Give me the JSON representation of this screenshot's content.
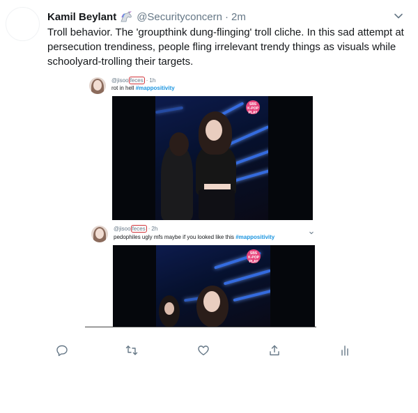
{
  "tweet": {
    "author_name": "Kamil Beylant",
    "author_emoji_icon": "unicorn-icon",
    "handle": "@Securityconcern",
    "separator": "·",
    "timestamp": "2m",
    "text": "Troll behavior. The 'groupthink dung-flinging' troll cliche.  In this sad attempt at persecution trendiness, people fling irrelevant trendy things as visuals while schoolyard-trolling their targets."
  },
  "embedded_screenshot": {
    "posts": [
      {
        "handle_prefix": "@jisoo",
        "handle_redacted": "feces",
        "separator": "·",
        "time": "1h",
        "text": "rot in hell",
        "hashtag": "#mappositivity",
        "media_logo": [
          "SBS",
          "K-POP",
          "PLAY"
        ]
      },
      {
        "handle_prefix": "@jisoo",
        "handle_redacted": "feces",
        "separator": "·",
        "time": "2h",
        "text": "pedophiles ugly mfs maybe if you looked like this",
        "hashtag": "#mappositivity",
        "media_logo": [
          "SBS",
          "K-POP",
          "PLAY"
        ]
      }
    ]
  },
  "actions": [
    {
      "name": "reply",
      "icon": "reply-icon"
    },
    {
      "name": "retweet",
      "icon": "retweet-icon"
    },
    {
      "name": "like",
      "icon": "heart-icon"
    },
    {
      "name": "share",
      "icon": "share-icon"
    },
    {
      "name": "analytics",
      "icon": "analytics-icon"
    }
  ],
  "colors": {
    "text_primary": "#14171a",
    "text_secondary": "#657786",
    "hashtag": "#1b95e0",
    "redaction": "#d0343a"
  }
}
